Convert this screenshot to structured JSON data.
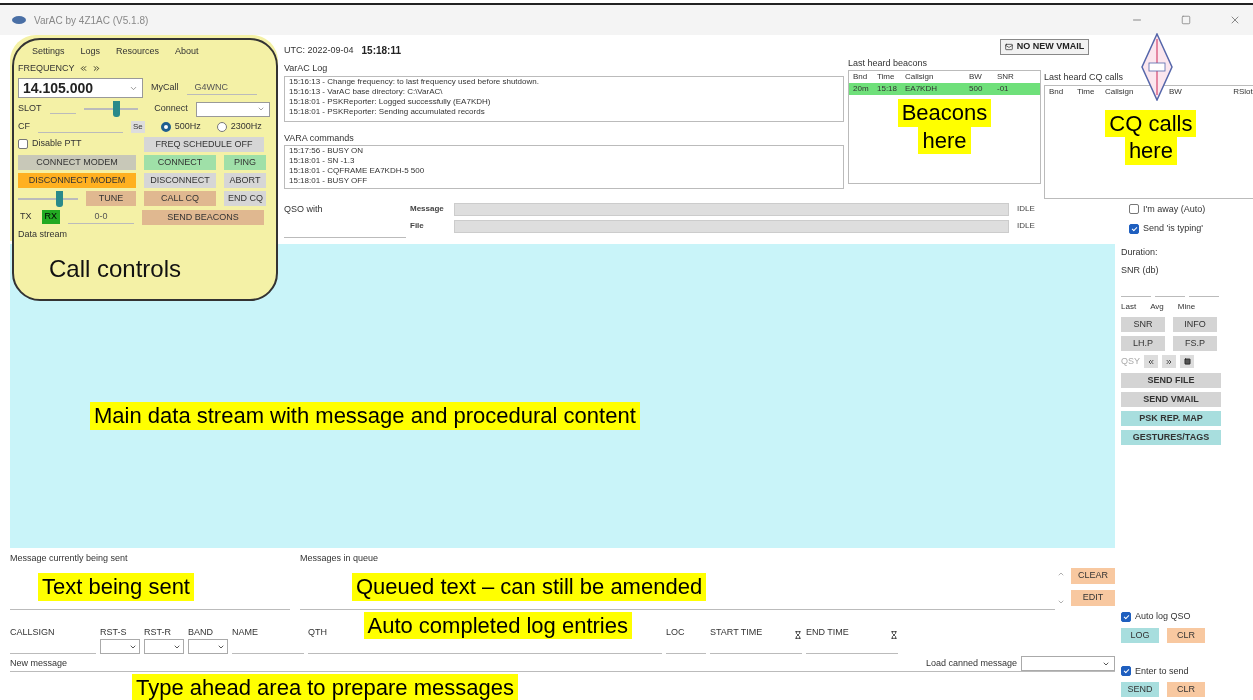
{
  "window": {
    "title": "VarAC by 4Z1AC (V5.1.8)"
  },
  "menu": [
    "Settings",
    "Logs",
    "Resources",
    "About"
  ],
  "call_controls": {
    "frequency_label": "FREQUENCY",
    "frequency": "14.105.000",
    "mycall_label": "MyCall",
    "mycall": "G4WNC",
    "slot_label": "SLOT",
    "slot": {
      "level": 0.6
    },
    "connect_label": "Connect",
    "cf_label": "CF",
    "cf_button": "Se",
    "bandwidth": [
      {
        "label": "500Hz",
        "selected": true
      },
      {
        "label": "2300Hz",
        "selected": false
      }
    ],
    "disable_ptt": {
      "label": "Disable PTT",
      "checked": false
    },
    "freq_schedule": {
      "label": "FREQ SCHEDULE OFF",
      "color": "#d6d6d6"
    },
    "connect_modem": {
      "label": "CONNECT MODEM",
      "color": "#c8c8b8"
    },
    "connect": {
      "label": "CONNECT",
      "color": "#9fe0a8"
    },
    "ping": {
      "label": "PING",
      "color": "#9fe0a8"
    },
    "disconnect_modem": {
      "label": "DISCONNECT MODEM",
      "color": "#ffb020"
    },
    "disconnect": {
      "label": "DISCONNECT",
      "color": "#d6d6d6"
    },
    "abort": {
      "label": "ABORT",
      "color": "#d6d6d6"
    },
    "tune_slider": {
      "level": 0.7
    },
    "tune": {
      "label": "TUNE",
      "color": "#e0b890"
    },
    "call_cq": {
      "label": "CALL CQ",
      "color": "#e0b890"
    },
    "end_cq": {
      "label": "END CQ",
      "color": "#d6d6d6"
    },
    "tx": {
      "label": "TX",
      "on": false
    },
    "rx": {
      "label": "RX",
      "on": true
    },
    "counter": "0-0",
    "send_beacons": {
      "label": "SEND BEACONS",
      "color": "#e0b890"
    },
    "data_stream_label": "Data stream"
  },
  "call_controls_note": "Call controls",
  "utc": {
    "label": "UTC: 2022-09-04",
    "time": "15:18:11"
  },
  "vmail": "NO NEW VMAIL",
  "varac_log": {
    "title": "VarAC Log",
    "lines": [
      "15:16:13 - Change frequency: to last frequency used before shutdown.",
      "15:16:13 - VarAC base directory: C:\\VarAC\\",
      "15:18:01 - PSKReporter: Logged successfully (EA7KDH)",
      "15:18:01 - PSKReporter: Sending accumulated records"
    ]
  },
  "vara_commands": {
    "title": "VARA commands",
    "lines": [
      "15:17:56 - BUSY ON",
      "15:18:01 - SN -1.3",
      "15:18:01 - CQFRAME EA7KDH-5 500",
      "15:18:01 - BUSY OFF"
    ]
  },
  "qso_with": "QSO with",
  "progress": [
    {
      "label": "Message",
      "status": "IDLE",
      "level": 0
    },
    {
      "label": "File",
      "status": "IDLE",
      "level": 0
    }
  ],
  "beacons": {
    "title": "Last heard beacons",
    "columns": [
      "Bnd",
      "Time",
      "Callsign",
      "BW",
      "SNR"
    ],
    "rows": [
      {
        "cells": [
          "20m",
          "15:18",
          "EA7KDH",
          "500",
          "-01"
        ],
        "selected": true
      }
    ],
    "note": [
      "Beacons",
      "here"
    ]
  },
  "cq_calls": {
    "title": "Last heard CQ calls",
    "columns": [
      "Bnd",
      "Time",
      "Callsign",
      "BW",
      "R",
      "Slot"
    ],
    "note": [
      "CQ calls",
      "here"
    ]
  },
  "sidebar": {
    "away": {
      "label": "I'm away (Auto)",
      "checked": false
    },
    "typing": {
      "label": "Send 'is typing'",
      "checked": true
    },
    "duration": "Duration:",
    "snr": "SNR (db)",
    "snr_columns": [
      "Last",
      "Avg",
      "Mine"
    ],
    "buttons": [
      [
        {
          "label": "SNR",
          "color": "#d4d4d4"
        },
        {
          "label": "INFO",
          "color": "#d4d4d4"
        }
      ],
      [
        {
          "label": "LH.P",
          "color": "#d4d4d4"
        },
        {
          "label": "FS.P",
          "color": "#d4d4d4"
        }
      ]
    ],
    "qsy": "QSY",
    "wide_buttons": [
      {
        "label": "SEND FILE",
        "color": "#d4d4d4"
      },
      {
        "label": "SEND VMAIL",
        "color": "#d4d4d4"
      },
      {
        "label": "PSK REP. MAP",
        "color": "#a8dede"
      },
      {
        "label": "GESTURES/TAGS",
        "color": "#a8dede"
      }
    ]
  },
  "data_stream_note": "Main data stream with message and procedural content",
  "sending": {
    "label": "Message currently being sent",
    "note": "Text being sent"
  },
  "queue": {
    "label": "Messages in queue",
    "note": "Queued text – can still be amended",
    "buttons": [
      {
        "label": "CLEAR",
        "color": "#f8c8a0"
      },
      {
        "label": "EDIT",
        "color": "#f8c8a0"
      }
    ]
  },
  "log_fields": [
    {
      "label": "CALLSIGN",
      "kind": "text"
    },
    {
      "label": "RST-S",
      "kind": "select"
    },
    {
      "label": "RST-R",
      "kind": "select"
    },
    {
      "label": "BAND",
      "kind": "select"
    },
    {
      "label": "NAME",
      "kind": "text"
    },
    {
      "label": "QTH",
      "kind": "wide"
    },
    {
      "label": "LOC",
      "kind": "text"
    },
    {
      "label": "START TIME",
      "kind": "time"
    },
    {
      "label": "END TIME",
      "kind": "time"
    }
  ],
  "log_note": "Auto completed log entries",
  "auto_log": {
    "label": "Auto log QSO",
    "checked": true,
    "buttons": [
      {
        "label": "LOG",
        "color": "#a8dede"
      },
      {
        "label": "CLR",
        "color": "#f8c8a0"
      }
    ]
  },
  "new_message": {
    "label": "New message",
    "canned_label": "Load canned message",
    "note": "Type ahead area to prepare messages"
  },
  "enter_send": {
    "label": "Enter to send",
    "checked": true,
    "buttons": [
      {
        "label": "SEND",
        "color": "#a8dede"
      },
      {
        "label": "CLR",
        "color": "#f8c8a0"
      }
    ]
  }
}
